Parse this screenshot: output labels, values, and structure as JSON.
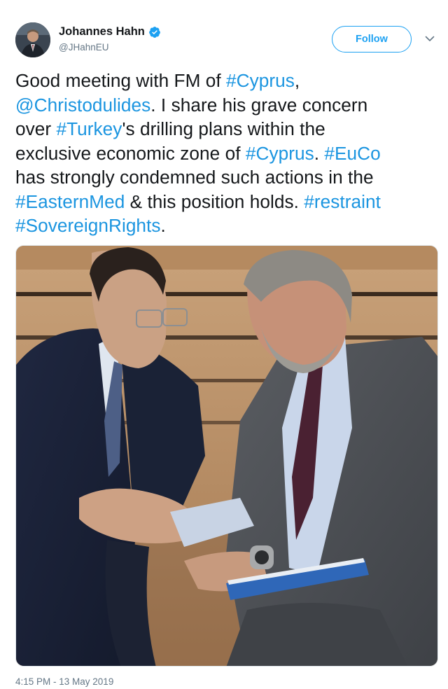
{
  "author": {
    "display_name": "Johannes Hahn",
    "handle": "@JHahnEU",
    "verified": true,
    "avatar_icon": "profile-photo"
  },
  "actions": {
    "follow_label": "Follow",
    "caret_icon": "chevron-down-icon"
  },
  "tweet": {
    "lines": [
      [
        {
          "text": "Good meeting with FM of "
        },
        {
          "text": "#Cyprus",
          "link": true
        },
        {
          "text": ","
        }
      ],
      [
        {
          "text": "@Christodulides",
          "link": true
        },
        {
          "text": ". I share  his grave concern"
        }
      ],
      [
        {
          "text": "over "
        },
        {
          "text": "#Turkey",
          "link": true
        },
        {
          "text": "'s drilling plans within the"
        }
      ],
      [
        {
          "text": "exclusive economic zone of "
        },
        {
          "text": "#Cyprus",
          "link": true
        },
        {
          "text": ". "
        },
        {
          "text": "#EuCo",
          "link": true
        }
      ],
      [
        {
          "text": "has strongly condemned such actions in the"
        }
      ],
      [
        {
          "text": "#EasternMed",
          "link": true
        },
        {
          "text": " & this position holds. "
        },
        {
          "text": "#restraint",
          "link": true
        }
      ],
      [
        {
          "text": "#SovereignRights",
          "link": true
        },
        {
          "text": "."
        }
      ]
    ]
  },
  "media": {
    "type": "photo",
    "icon": "photo-two-men-talking"
  },
  "timestamp": "4:15 PM - 13 May 2019",
  "colors": {
    "link": "#1b95e0",
    "follow_accent": "#1da1f2",
    "secondary_text": "#657786",
    "primary_text": "#14171a"
  }
}
